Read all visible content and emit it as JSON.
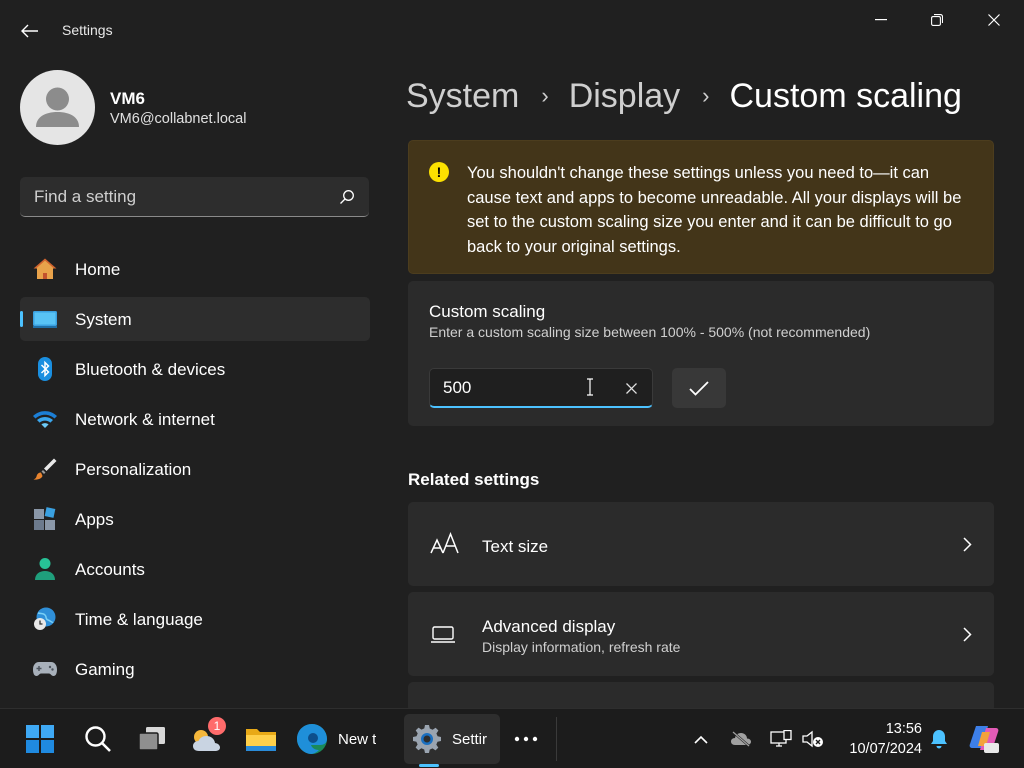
{
  "app": {
    "title": "Settings"
  },
  "profile": {
    "name": "VM6",
    "email": "VM6@collabnet.local"
  },
  "search": {
    "placeholder": "Find a setting"
  },
  "nav": [
    {
      "label": "Home",
      "icon": "home-icon"
    },
    {
      "label": "System",
      "icon": "system-icon",
      "active": true
    },
    {
      "label": "Bluetooth & devices",
      "icon": "bluetooth-icon"
    },
    {
      "label": "Network & internet",
      "icon": "wifi-icon"
    },
    {
      "label": "Personalization",
      "icon": "brush-icon"
    },
    {
      "label": "Apps",
      "icon": "apps-icon"
    },
    {
      "label": "Accounts",
      "icon": "person-icon"
    },
    {
      "label": "Time & language",
      "icon": "globe-clock-icon"
    },
    {
      "label": "Gaming",
      "icon": "gamepad-icon"
    }
  ],
  "breadcrumb": {
    "level1": "System",
    "level2": "Display",
    "current": "Custom scaling",
    "separator": "›"
  },
  "warning": {
    "text": "You shouldn't change these settings unless you need to—it can cause text and apps to become unreadable. All your displays will be set to the custom scaling size you enter and it can be difficult to go back to your original settings.",
    "icon": "!"
  },
  "custom_scaling": {
    "title": "Custom scaling",
    "description": "Enter a custom scaling size between 100% - 500% (not recommended)",
    "value": "500"
  },
  "related": {
    "title": "Related settings",
    "items": [
      {
        "title": "Text size",
        "subtitle": ""
      },
      {
        "title": "Advanced display",
        "subtitle": "Display information, refresh rate"
      }
    ]
  },
  "taskbar": {
    "edge_label": "New t",
    "settings_label": "Settir",
    "widgets_badge": "1",
    "time": "13:56",
    "date": "10/07/2024"
  },
  "colors": {
    "accent": "#4cc2ff",
    "warning_bg": "#433519",
    "warning_icon": "#fce100"
  }
}
